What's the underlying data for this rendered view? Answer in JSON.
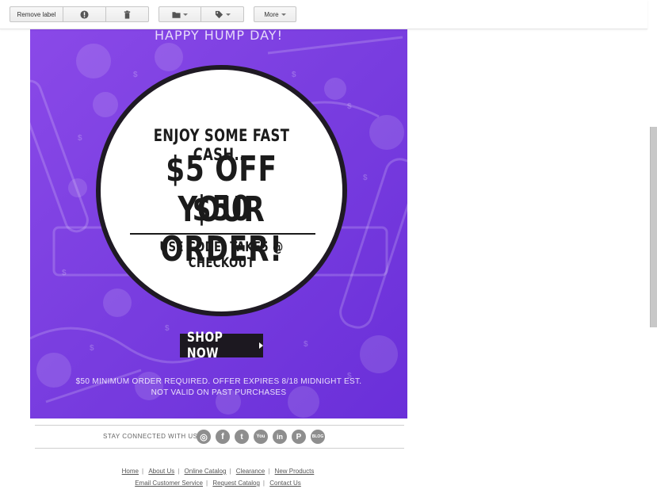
{
  "toolbar": {
    "remove_label": "Remove label",
    "more_label": "More",
    "icons": {
      "report": "exclamation-icon",
      "delete": "trash-icon",
      "move": "folder-icon",
      "labels": "tag-icon"
    }
  },
  "promo": {
    "top_heading": "HAPPY HUMP DAY!",
    "line1": "ENJOY SOME FAST CASH...",
    "line2": "$5 OFF YOUR",
    "line3": "$50 ORDER!",
    "code_line": "USE CODE: TAKE5 @ CHECKOUT",
    "cta": "SHOP NOW",
    "fineprint1": "$50 MINIMUM ORDER REQUIRED. OFFER EXPIRES 8/18 MIDNIGHT EST.",
    "fineprint2": "NOT VALID ON PAST PURCHASES",
    "colors": {
      "background": "#7a3ee0",
      "circle": "#ffffff",
      "ring": "#1f1a24",
      "cta_bg": "#1c1820"
    }
  },
  "social": {
    "label": "STAY CONNECTED WITH US",
    "icons": [
      {
        "name": "instagram-icon",
        "glyph": "◎"
      },
      {
        "name": "facebook-icon",
        "glyph": "f"
      },
      {
        "name": "twitter-icon",
        "glyph": "t"
      },
      {
        "name": "youtube-icon",
        "glyph": "You"
      },
      {
        "name": "linkedin-icon",
        "glyph": "in"
      },
      {
        "name": "pinterest-icon",
        "glyph": "P"
      },
      {
        "name": "blog-icon",
        "glyph": "BLOG"
      }
    ]
  },
  "footer": {
    "row1": [
      "Home",
      "About Us",
      "Online Catalog",
      "Clearance",
      "New Products"
    ],
    "row2": [
      "Email Customer Service",
      "Request Catalog",
      "Contact Us"
    ]
  }
}
